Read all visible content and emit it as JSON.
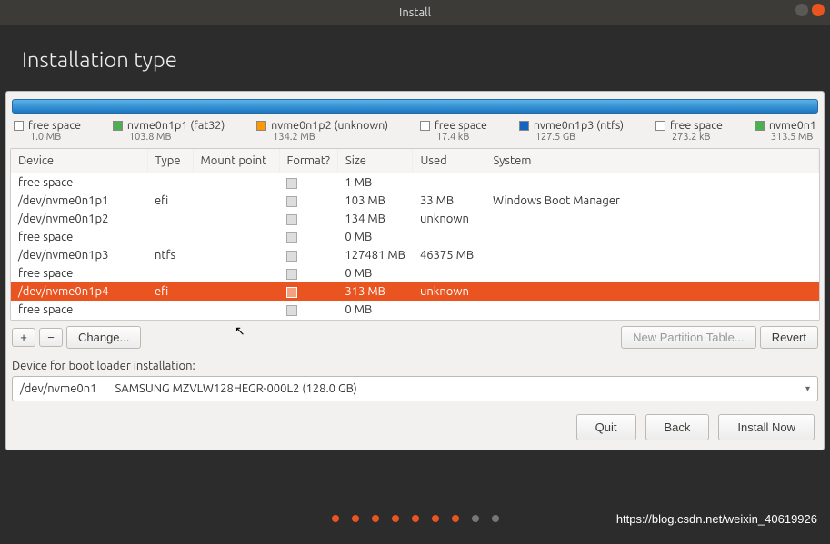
{
  "window": {
    "title": "Install"
  },
  "page": {
    "heading": "Installation type"
  },
  "legend": [
    {
      "label": "free space",
      "size": "1.0 MB",
      "color": "#ffffff"
    },
    {
      "label": "nvme0n1p1 (fat32)",
      "size": "103.8 MB",
      "color": "#4caf50"
    },
    {
      "label": "nvme0n1p2 (unknown)",
      "size": "134.2 MB",
      "color": "#ff9800"
    },
    {
      "label": "free space",
      "size": "17.4 kB",
      "color": "#ffffff"
    },
    {
      "label": "nvme0n1p3 (ntfs)",
      "size": "127.5 GB",
      "color": "#1565c0"
    },
    {
      "label": "free space",
      "size": "273.2 kB",
      "color": "#ffffff"
    },
    {
      "label": "nvme0n1",
      "size": "313.5 MB",
      "color": "#4caf50"
    }
  ],
  "columns": {
    "device": "Device",
    "type": "Type",
    "mount": "Mount point",
    "format": "Format?",
    "size": "Size",
    "used": "Used",
    "system": "System"
  },
  "rows": [
    {
      "device": "free space",
      "type": "",
      "mount": "",
      "size": "1 MB",
      "used": "",
      "system": "",
      "selected": false
    },
    {
      "device": "/dev/nvme0n1p1",
      "type": "efi",
      "mount": "",
      "size": "103 MB",
      "used": "33 MB",
      "system": "Windows Boot Manager",
      "selected": false
    },
    {
      "device": "/dev/nvme0n1p2",
      "type": "",
      "mount": "",
      "size": "134 MB",
      "used": "unknown",
      "system": "",
      "selected": false
    },
    {
      "device": "free space",
      "type": "",
      "mount": "",
      "size": "0 MB",
      "used": "",
      "system": "",
      "selected": false
    },
    {
      "device": "/dev/nvme0n1p3",
      "type": "ntfs",
      "mount": "",
      "size": "127481 MB",
      "used": "46375 MB",
      "system": "",
      "selected": false
    },
    {
      "device": "free space",
      "type": "",
      "mount": "",
      "size": "0 MB",
      "used": "",
      "system": "",
      "selected": false
    },
    {
      "device": "/dev/nvme0n1p4",
      "type": "efi",
      "mount": "",
      "size": "313 MB",
      "used": "unknown",
      "system": "",
      "selected": true
    },
    {
      "device": "free space",
      "type": "",
      "mount": "",
      "size": "0 MB",
      "used": "",
      "system": "",
      "selected": false
    }
  ],
  "toolbar": {
    "add": "+",
    "remove": "−",
    "change": "Change...",
    "new_table": "New Partition Table...",
    "revert": "Revert"
  },
  "bootloader": {
    "label": "Device for boot loader installation:",
    "device": "/dev/nvme0n1",
    "desc": "SAMSUNG MZVLW128HEGR-000L2 (128.0 GB)"
  },
  "nav": {
    "quit": "Quit",
    "back": "Back",
    "install": "Install Now"
  },
  "watermark": "https://blog.csdn.net/weixin_40619926"
}
